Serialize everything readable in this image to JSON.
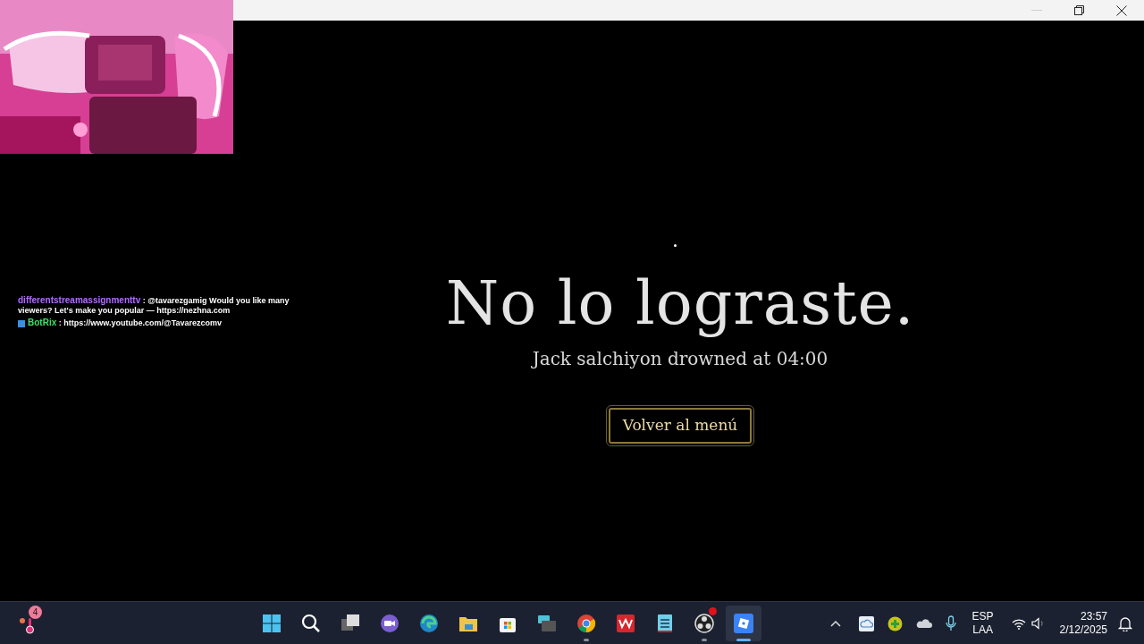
{
  "chat": [
    {
      "user": "differentstreamassignmenttv",
      "color": "#b36bff",
      "badge": false,
      "text": ": @tavarezgamig Would you like many viewers? Let's make you popular — https://nezhna.com"
    },
    {
      "user": "BotRix",
      "color": "#3ee06a",
      "badge": true,
      "text": ": https://www.youtube.com/@Tavarezcomv"
    }
  ],
  "game": {
    "title": "No lo lograste.",
    "subtitle": "Jack salchiyon drowned at 04:00",
    "button": "Volver al menú"
  },
  "taskbar": {
    "widget_badge": "4",
    "apps": [
      {
        "kind": "start",
        "running": false,
        "active": false,
        "alert": false
      },
      {
        "kind": "search",
        "running": false,
        "active": false,
        "alert": false
      },
      {
        "kind": "taskview",
        "running": false,
        "active": false,
        "alert": false
      },
      {
        "kind": "meet",
        "running": false,
        "active": false,
        "alert": false
      },
      {
        "kind": "edge",
        "running": false,
        "active": false,
        "alert": false
      },
      {
        "kind": "folder",
        "running": false,
        "active": false,
        "alert": false
      },
      {
        "kind": "store",
        "running": false,
        "active": false,
        "alert": false
      },
      {
        "kind": "keyboard",
        "running": false,
        "active": false,
        "alert": false
      },
      {
        "kind": "chrome",
        "running": true,
        "active": false,
        "alert": false
      },
      {
        "kind": "wps",
        "running": false,
        "active": false,
        "alert": false
      },
      {
        "kind": "notepad",
        "running": false,
        "active": false,
        "alert": false
      },
      {
        "kind": "obs",
        "running": true,
        "active": false,
        "alert": true
      },
      {
        "kind": "roblox",
        "running": true,
        "active": true,
        "alert": false
      }
    ],
    "language": [
      "ESP",
      "LAA"
    ],
    "time": "23:57",
    "date": "2/12/2025"
  }
}
